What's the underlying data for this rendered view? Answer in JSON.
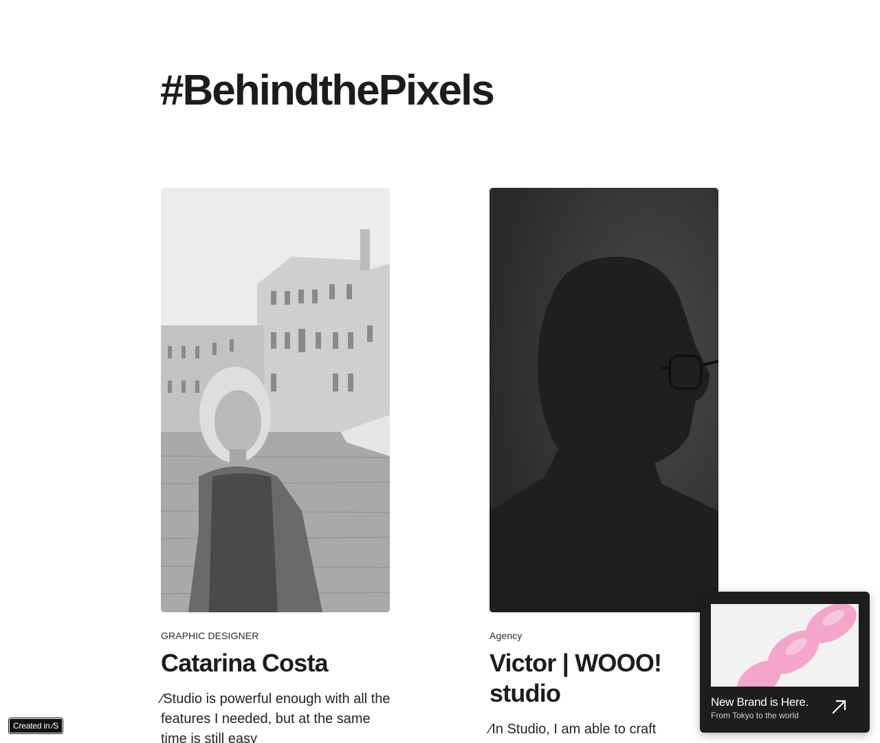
{
  "header": {
    "title": "#BehindthePixels"
  },
  "cards": [
    {
      "role": "GRAPHIC DESIGNER",
      "name": "Catarina Costa",
      "quote": "∕Studio is powerful enough with all the features I needed, but at the same time is still easy"
    },
    {
      "role": "Agency",
      "name": "Victor | WOOO! studio",
      "quote": "∕In Studio, I am able to craft"
    }
  ],
  "badge": {
    "label": "Created in ∕S"
  },
  "promo": {
    "title": "New Brand is Here.",
    "subtitle": "From Tokyo to the world",
    "icon": "arrow-up-right-icon"
  }
}
